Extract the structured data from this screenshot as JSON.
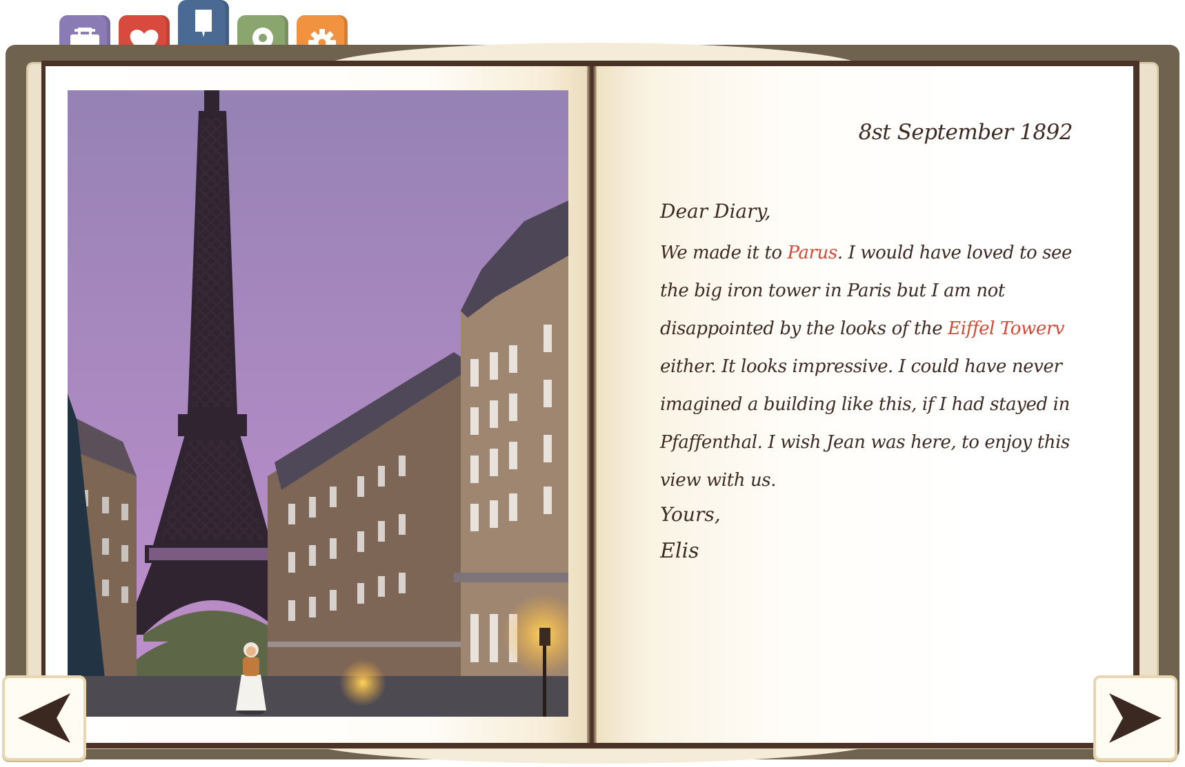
{
  "tabs": [
    {
      "name": "inventory",
      "icon": "suitcase-icon",
      "color": "#8a7bb4",
      "active": false
    },
    {
      "name": "favorites",
      "icon": "heart-icon",
      "color": "#d94a3e",
      "active": false
    },
    {
      "name": "diary",
      "icon": "bookmark-icon",
      "color": "#4a6a93",
      "active": true
    },
    {
      "name": "map",
      "icon": "location-pin-icon",
      "color": "#8aa56e",
      "active": false
    },
    {
      "name": "settings",
      "icon": "gear-icon",
      "color": "#f0923f",
      "active": false
    }
  ],
  "diary": {
    "date": "8st September 1892",
    "greeting": "Dear Diary,",
    "body": {
      "part1": "We made it to ",
      "highlight1": "Parus",
      "part2": ". I would have loved to see the big iron tower in Paris but I am not disappointed by the looks of the ",
      "highlight2": "Eiffel Towerv",
      "part3": " either. It looks impressive. I could have never imagined a building like this, if I had stayed in Pfaffenthal. I wish Jean was here, to enjoy this view with us."
    },
    "closing": "Yours,",
    "signature": "Elis"
  },
  "navigation": {
    "prev_icon": "arrow-left-icon",
    "next_icon": "arrow-right-icon"
  },
  "colors": {
    "highlight_text": "#d24a36",
    "ink": "#3d2a22",
    "book_cover": "#6f624f",
    "page_frame": "#4a3227",
    "sky_top": "#9682b4",
    "sky_bottom": "#b98cc6"
  }
}
